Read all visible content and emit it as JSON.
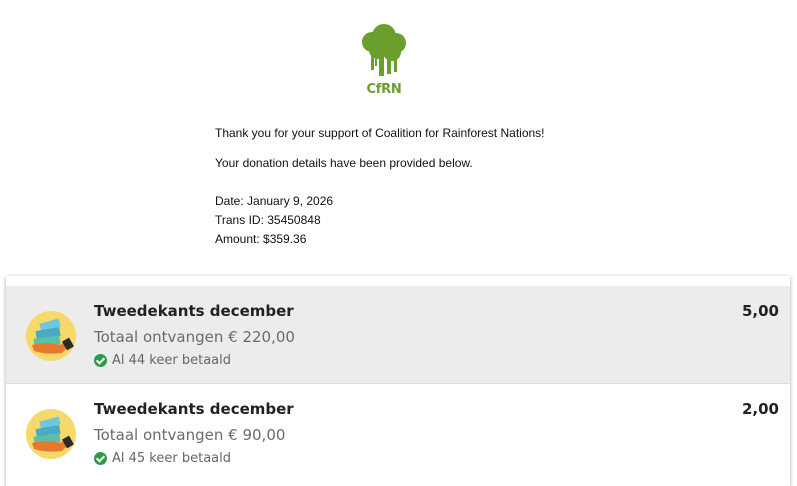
{
  "email": {
    "logo_text": "CfRN",
    "thank_you": "Thank you for your support of Coalition for Rainforest Nations!",
    "details_intro": "Your donation details have been provided below.",
    "date_line": "Date: January 9, 2026",
    "trans_line": "Trans ID: 35450848",
    "amount_line": "Amount: $359.36",
    "brand_color": "#6a9f2e"
  },
  "transactions": [
    {
      "title": "Tweedekants december",
      "amount": "5,00",
      "total": "Totaal ontvangen € 220,00",
      "status": "Al 44 keer betaald",
      "icon": "money-hand-icon"
    },
    {
      "title": "Tweedekants december",
      "amount": "2,00",
      "total": "Totaal ontvangen € 90,00",
      "status": "Al 45 keer betaald",
      "icon": "money-hand-icon"
    }
  ],
  "colors": {
    "selected_row": "#ececec",
    "status_check": "#2e9b4a",
    "avatar_bg": "#f7d86a"
  }
}
